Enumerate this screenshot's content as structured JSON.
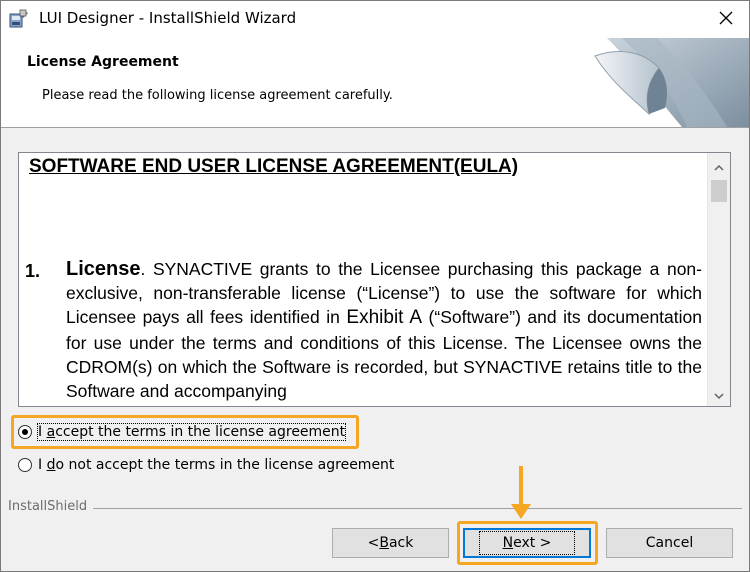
{
  "window": {
    "title": "LUI Designer - InstallShield Wizard"
  },
  "banner": {
    "title": "License Agreement",
    "subtitle": "Please read the following license agreement carefully."
  },
  "license": {
    "heading": "SOFTWARE END USER LICENSE AGREEMENT(EULA)",
    "clause_number": "1.",
    "clause_title": "License",
    "clause_text_1": ". SYNACTIVE grants to the Licensee purchasing this package a non-exclusive, non-transferable license (“License”) to use the software for which Licensee pays all fees identified in ",
    "clause_exhibit": "Exhibit A",
    "clause_text_2": " (“Software”) and its documentation for use under the terms and conditions of this License. The Licensee owns the CDROM(s) on which the Software is recorded, but SYNACTIVE retains title to the Software and accompanying"
  },
  "options": {
    "accept": {
      "label_pre": "I ",
      "label_accel": "a",
      "label_post": "ccept the terms in the license agreement",
      "checked": true
    },
    "decline": {
      "label_pre": "I ",
      "label_accel": "d",
      "label_post": "o not accept the terms in the license agreement",
      "checked": false
    }
  },
  "footer": {
    "brand": "InstallShield",
    "back_pre": "< ",
    "back_accel": "B",
    "back_post": "ack",
    "next_accel": "N",
    "next_post": "ext >",
    "cancel": "Cancel"
  },
  "colors": {
    "highlight": "#f5a623",
    "default_button_border": "#0078d7"
  },
  "icons": {
    "app": "installer-icon",
    "close": "close-icon",
    "scroll_up": "chevron-up-icon",
    "scroll_down": "chevron-down-icon",
    "annotation_arrow": "arrow-down-icon"
  }
}
